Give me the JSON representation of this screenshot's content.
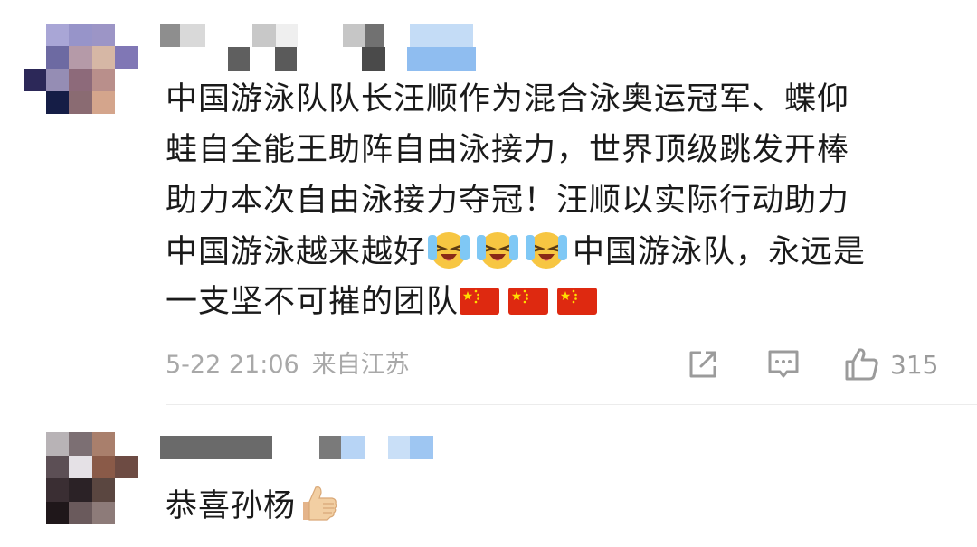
{
  "comments": [
    {
      "text_lines": [
        "中国游泳队队长汪顺作为混合泳奥运冠军、蝶仰",
        "蛙自全能王助阵自由泳接力，世界顶级跳发开棒",
        "助力本次自由泳接力夺冠！汪顺以实际行动助力"
      ],
      "line4_before": "中国游泳越来越好",
      "line4_after": "中国游泳队，永远是",
      "line5_text": "一支坚不可摧的团队",
      "emoji_laugh": "laughing-crying-emoji",
      "emoji_flag": "china-flag-emoji",
      "date": "5-22 21:06",
      "location": "来自江苏",
      "like_count": "315",
      "icons": {
        "share": "share-icon",
        "reply": "comment-icon",
        "like": "thumbs-up-icon"
      }
    },
    {
      "text": "恭喜孙杨",
      "emoji": "thumbs-up-emoji"
    }
  ],
  "colors": {
    "text": "#1a1a1a",
    "meta": "#a8a8a8",
    "divider": "#ececec",
    "username_highlight": "#9cc4f2"
  }
}
